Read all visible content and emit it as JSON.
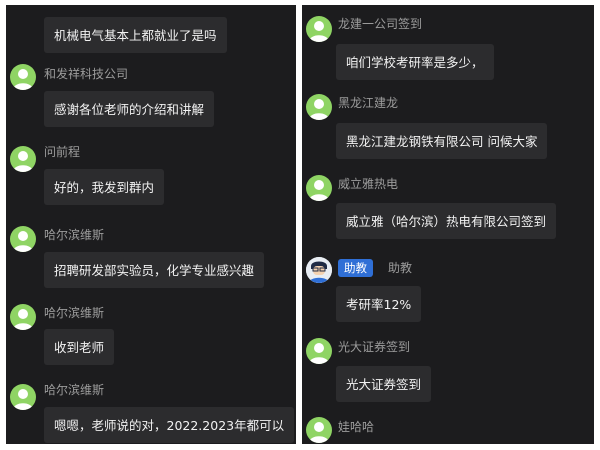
{
  "left_chat": {
    "messages": [
      {
        "sender": "",
        "text": "机械电气基本上都就业了是吗"
      },
      {
        "sender": "和发祥科技公司",
        "text": "感谢各位老师的介绍和讲解"
      },
      {
        "sender": "问前程",
        "text": "好的，我发到群内"
      },
      {
        "sender": "哈尔滨维斯",
        "text": "招聘研发部实验员，化学专业感兴趣"
      },
      {
        "sender": "哈尔滨维斯",
        "text": "收到老师"
      },
      {
        "sender": "哈尔滨维斯",
        "text": "嗯嗯，老师说的对，2022.2023年都可以"
      }
    ]
  },
  "right_chat": {
    "messages": [
      {
        "sender": "龙建一公司签到",
        "text": "咱们学校考研率是多少，"
      },
      {
        "sender": "黑龙江建龙",
        "text": "黑龙江建龙钢铁有限公司  问候大家"
      },
      {
        "sender": "威立雅热电",
        "text": "威立雅（哈尔滨）热电有限公司签到"
      },
      {
        "sender": "助教",
        "role_badge": "助教",
        "text": "考研率12%"
      },
      {
        "sender": "光大证券签到",
        "text": "光大证券签到"
      },
      {
        "sender": "娃哈哈",
        "text": ""
      }
    ]
  },
  "colors": {
    "background": "#1c1c1e",
    "bubble": "#2c2c2e",
    "sender_name": "#9c9c9c",
    "avatar_default": "#8fd464",
    "badge": "#2f6fd6"
  },
  "icons": {
    "default_avatar": "person-silhouette-icon",
    "teacher_avatar": "teacher-avatar-icon"
  }
}
